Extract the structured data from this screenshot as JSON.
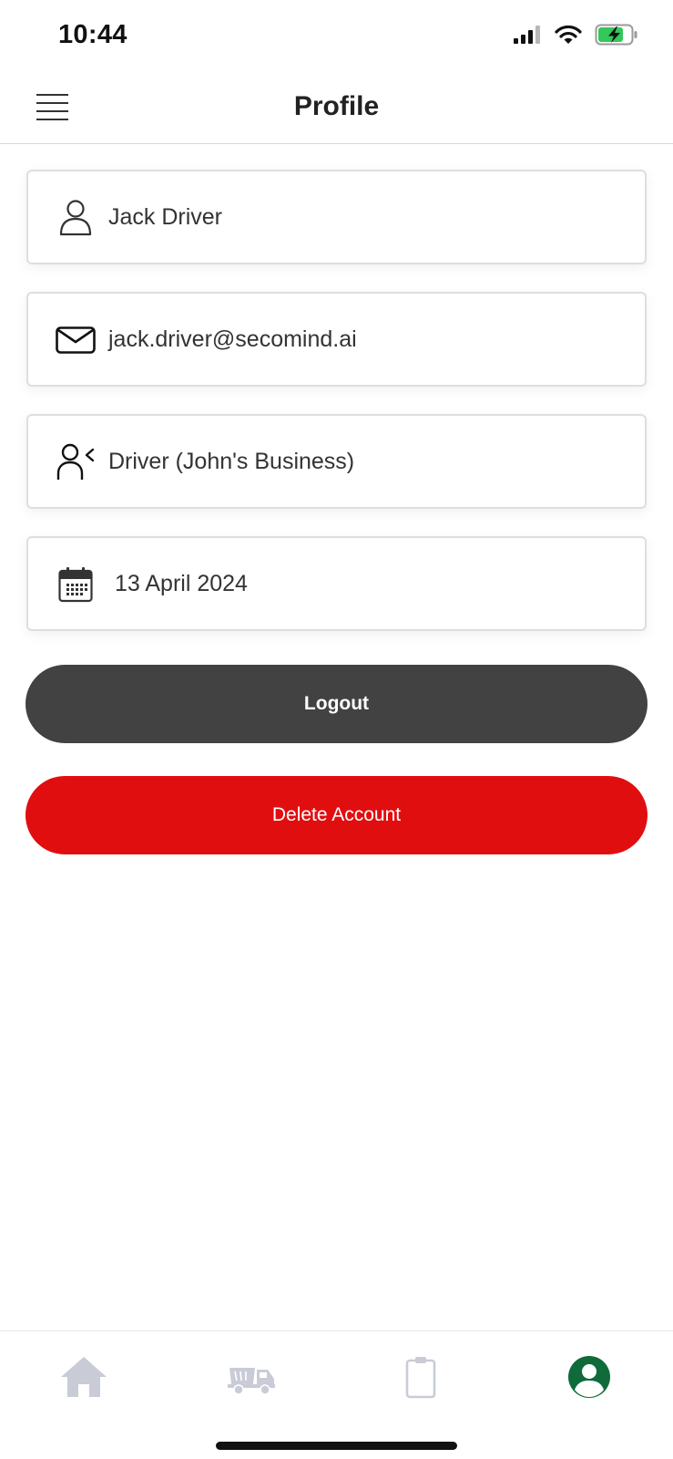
{
  "status_bar": {
    "time": "10:44"
  },
  "header": {
    "title": "Profile",
    "menu_icon": "hamburger-menu-icon"
  },
  "profile": {
    "name": "Jack Driver",
    "email": "jack.driver@secomind.ai",
    "role": "Driver (John's Business)",
    "date": "13 April 2024"
  },
  "actions": {
    "logout_label": "Logout",
    "delete_label": "Delete Account"
  },
  "tab_bar": {
    "tabs": [
      {
        "icon": "home-icon",
        "active": false
      },
      {
        "icon": "truck-icon",
        "active": false
      },
      {
        "icon": "clipboard-icon",
        "active": false
      },
      {
        "icon": "profile-icon",
        "active": true
      }
    ]
  },
  "colors": {
    "logout_bg": "#424242",
    "delete_bg": "#e10e10",
    "active_tab": "#0f6b3a",
    "inactive_tab": "#c9ccd6",
    "battery_fill": "#34c759"
  }
}
